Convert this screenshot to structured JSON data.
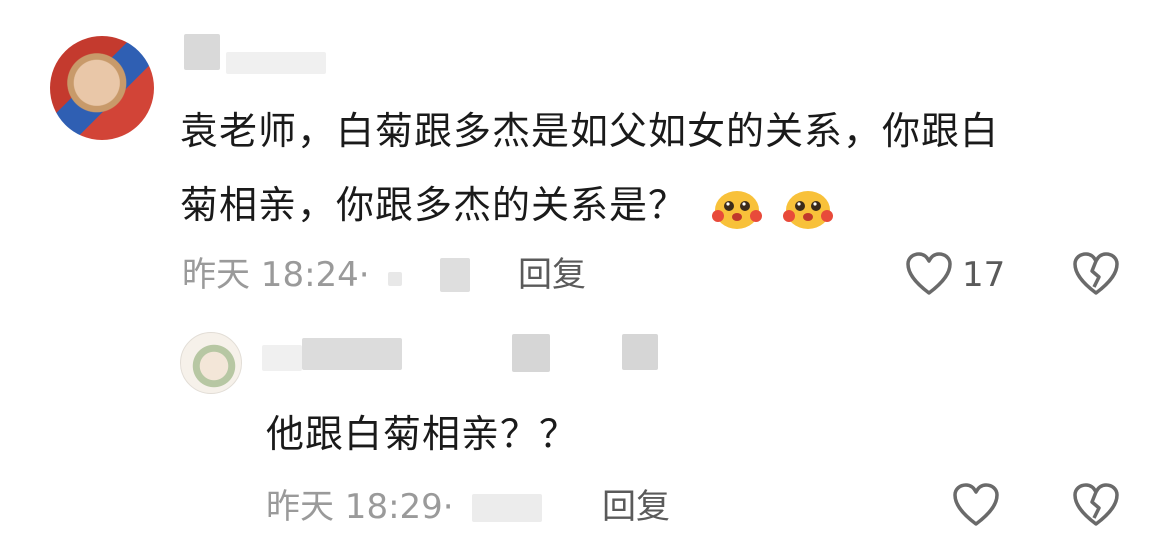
{
  "comment": {
    "text_line1": "袁老师，白菊跟多杰是如父如女的关系，你跟白",
    "text_line2": "菊相亲，你跟多杰的关系是？",
    "time": "昨天 18:24·",
    "reply_label": "回复",
    "like_count": "17",
    "emoji_icon": "face-emoji-icon"
  },
  "reply": {
    "text": "他跟白菊相亲？？",
    "time": "昨天 18:29·",
    "reply_label": "回复"
  },
  "colors": {
    "text": "#1a1a1a",
    "meta": "#9a9a9a",
    "icon": "#6a6a6a",
    "emoji_face": "#f8c13a",
    "emoji_cheek": "#e84a3a"
  }
}
